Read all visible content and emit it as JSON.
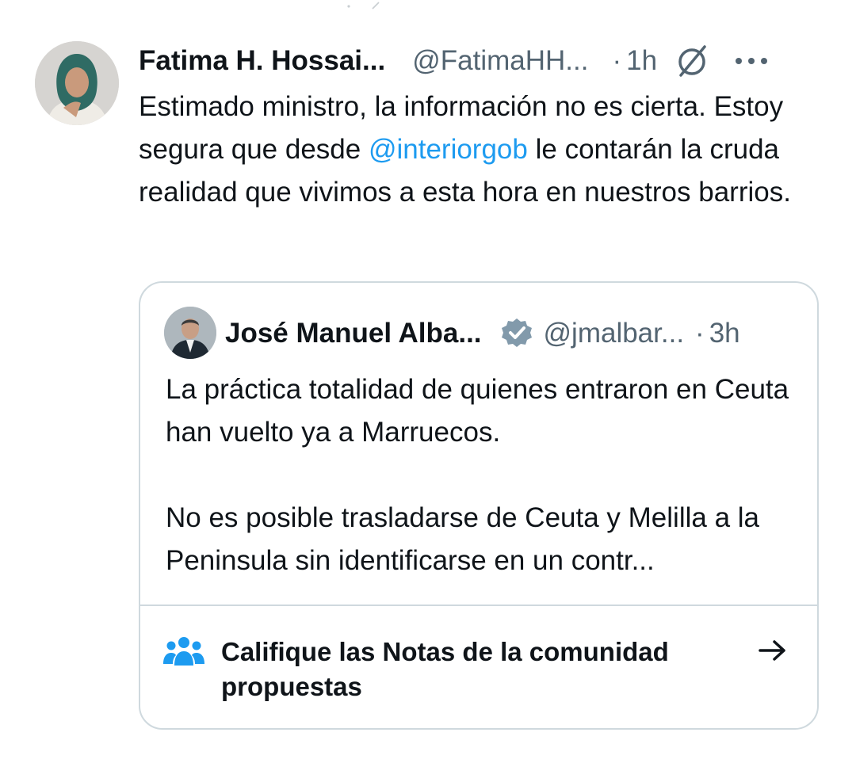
{
  "tweet": {
    "author_name": "Fatima H. Hossai...",
    "author_handle": "@FatimaHH...",
    "separator": "·",
    "time": "1h",
    "text_parts": {
      "before": "Estimado ministro, la información no es cierta. Estoy segura que desde ",
      "mention": "@interiorgob",
      "after": " le contarán la cruda realidad que vivimos a esta hora en nuestros barrios."
    }
  },
  "quoted_tweet": {
    "author_name": "José Manuel Alba...",
    "author_handle": "@jmalbar...",
    "separator": "·",
    "time": "3h",
    "paragraph_1": "La práctica totalidad de quienes entraron en Ceuta han vuelto ya a Marruecos.",
    "paragraph_2": "No es posible trasladarse de Ceuta y Melilla a la Peninsula sin identificarse en un contr..."
  },
  "community_notes": {
    "label": "Califique las Notas de la comunidad propuestas"
  },
  "icons": {
    "grok": "grok-icon",
    "more": "more-icon",
    "verified": "verified-badge-icon",
    "community": "people-icon",
    "arrow": "arrow-right-icon"
  },
  "colors": {
    "mention": "#1d9bf0",
    "secondary_text": "#536471",
    "border": "#cfd9de",
    "community_icon": "#1d9bf0",
    "verified_badge": "#829aab"
  }
}
